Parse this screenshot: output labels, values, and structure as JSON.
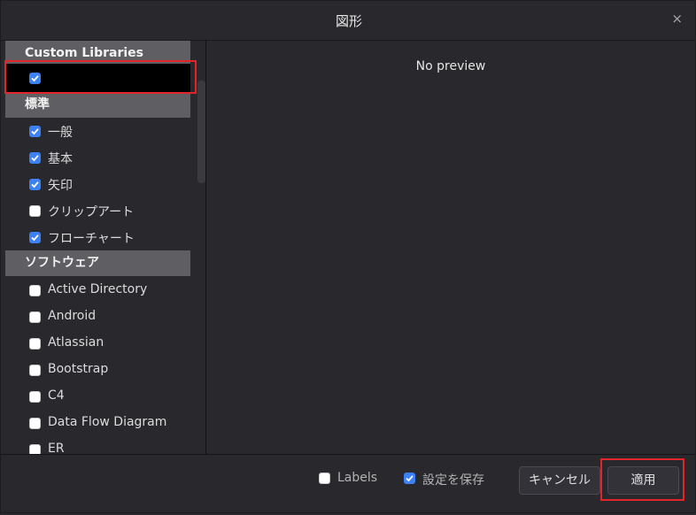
{
  "dialog": {
    "title": "図形",
    "close_label": "×"
  },
  "sidebar": {
    "custom_section": "Custom Libraries",
    "custom_item": {
      "label": "",
      "checked": true
    },
    "standard_section": "標準",
    "standard_items": [
      {
        "label": "一般",
        "checked": true
      },
      {
        "label": "基本",
        "checked": true
      },
      {
        "label": "矢印",
        "checked": true
      },
      {
        "label": "クリップアート",
        "checked": false
      },
      {
        "label": "フローチャート",
        "checked": true
      }
    ],
    "software_section": "ソフトウェア",
    "software_items": [
      {
        "label": "Active Directory",
        "checked": false
      },
      {
        "label": "Android",
        "checked": false
      },
      {
        "label": "Atlassian",
        "checked": false
      },
      {
        "label": "Bootstrap",
        "checked": false
      },
      {
        "label": "C4",
        "checked": false
      },
      {
        "label": "Data Flow Diagram",
        "checked": false
      },
      {
        "label": "ER",
        "checked": false
      }
    ]
  },
  "preview": {
    "text": "No preview"
  },
  "footer": {
    "labels_option": {
      "label": "Labels",
      "checked": false
    },
    "save_option": {
      "label": "設定を保存",
      "checked": true
    },
    "cancel_label": "キャンセル",
    "apply_label": "適用"
  },
  "colors": {
    "accent": "#3c82f6",
    "highlight": "#e3242b",
    "background": "#29282d"
  }
}
